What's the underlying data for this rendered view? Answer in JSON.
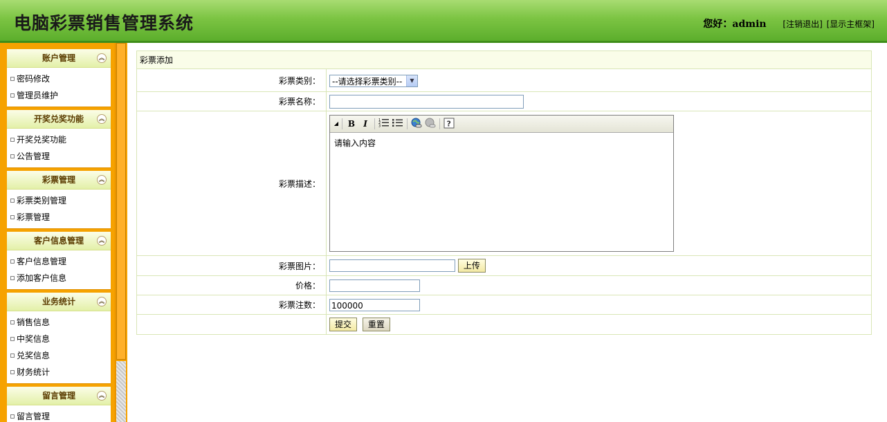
{
  "header": {
    "title": "电脑彩票销售管理系统",
    "greeting": "您好：admin",
    "logout": "[注销退出]",
    "show_frame": "[显示主框架]"
  },
  "sidebar": {
    "groups": [
      {
        "title": "账户管理",
        "items": [
          "密码修改",
          "管理员维护"
        ]
      },
      {
        "title": "开奖兑奖功能",
        "items": [
          "开奖兑奖功能",
          "公告管理"
        ]
      },
      {
        "title": "彩票管理",
        "items": [
          "彩票类别管理",
          "彩票管理"
        ]
      },
      {
        "title": "客户信息管理",
        "items": [
          "客户信息管理",
          "添加客户信息"
        ]
      },
      {
        "title": "业务统计",
        "items": [
          "销售信息",
          "中奖信息",
          "兑奖信息",
          "财务统计"
        ]
      },
      {
        "title": "留言管理",
        "items": [
          "留言管理"
        ]
      }
    ],
    "collapse_glyph": "︽"
  },
  "form": {
    "caption": "彩票添加",
    "category_label": "彩票类别：",
    "category_value": "--请选择彩票类别--",
    "name_label": "彩票名称：",
    "name_value": "",
    "desc_label": "彩票描述：",
    "desc_content": "请输入内容",
    "image_label": "彩票图片：",
    "upload_button": "上传",
    "price_label": "价格：",
    "price_value": "",
    "count_label": "彩票注数：",
    "count_value": "100000",
    "submit_button": "提交",
    "reset_button": "重置"
  },
  "editor_toolbar": {
    "bold": "B",
    "italic": "I"
  }
}
